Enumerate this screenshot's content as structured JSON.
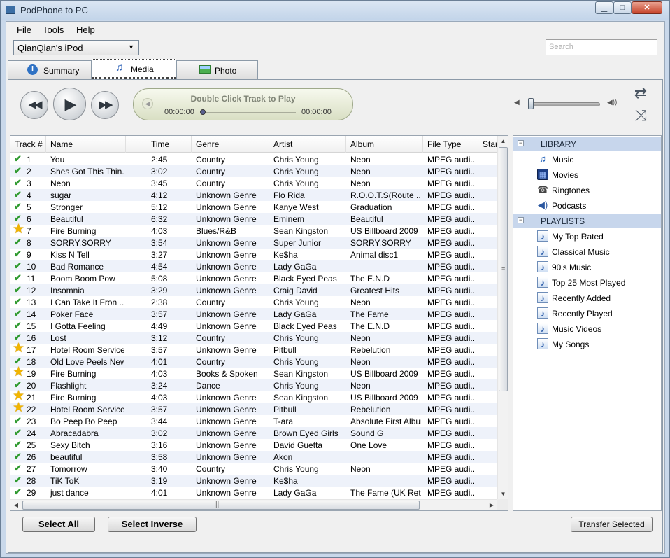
{
  "window": {
    "title": "PodPhone to PC"
  },
  "menu": {
    "file": "File",
    "tools": "Tools",
    "help": "Help"
  },
  "device": {
    "selected": "QianQian's iPod"
  },
  "search": {
    "placeholder": "Search"
  },
  "tabs": {
    "summary": "Summary",
    "media": "Media",
    "photo": "Photo"
  },
  "player": {
    "now_playing": "Double Click Track to Play",
    "time_current": "00:00:00",
    "time_total": "00:00:00"
  },
  "table": {
    "columns": [
      "Track #",
      "Name",
      "Time",
      "Genre",
      "Artist",
      "Album",
      "File Type",
      "Star"
    ],
    "rows": [
      {
        "num": "1",
        "name": "You",
        "time": "2:45",
        "genre": "Country",
        "artist": "Chris Young",
        "album": "Neon",
        "type": "MPEG audi...",
        "starred": false
      },
      {
        "num": "2",
        "name": "Shes Got This Thin...",
        "time": "3:02",
        "genre": "Country",
        "artist": "Chris Young",
        "album": "Neon",
        "type": "MPEG audi...",
        "starred": false
      },
      {
        "num": "3",
        "name": "Neon",
        "time": "3:45",
        "genre": "Country",
        "artist": "Chris Young",
        "album": "Neon",
        "type": "MPEG audi...",
        "starred": false
      },
      {
        "num": "4",
        "name": "sugar",
        "time": "4:12",
        "genre": "Unknown Genre",
        "artist": "Flo Rida",
        "album": "R.O.O.T.S(Route ...",
        "type": "MPEG audi...",
        "starred": false
      },
      {
        "num": "5",
        "name": "Stronger",
        "time": "5:12",
        "genre": "Unknown Genre",
        "artist": "Kanye West",
        "album": "Graduation",
        "type": "MPEG audi...",
        "starred": false
      },
      {
        "num": "6",
        "name": "Beautiful",
        "time": "6:32",
        "genre": "Unknown Genre",
        "artist": "Eminem",
        "album": "Beautiful",
        "type": "MPEG audi...",
        "starred": false
      },
      {
        "num": "7",
        "name": "Fire Burning",
        "time": "4:03",
        "genre": "Blues/R&B",
        "artist": "Sean Kingston",
        "album": "US Billboard 2009 ...",
        "type": "MPEG audi...",
        "starred": true
      },
      {
        "num": "8",
        "name": "SORRY,SORRY",
        "time": "3:54",
        "genre": "Unknown Genre",
        "artist": "Super Junior",
        "album": "SORRY,SORRY",
        "type": "MPEG audi...",
        "starred": false
      },
      {
        "num": "9",
        "name": "Kiss N Tell",
        "time": "3:27",
        "genre": "Unknown Genre",
        "artist": "Ke$ha",
        "album": "Animal disc1",
        "type": "MPEG audi...",
        "starred": false
      },
      {
        "num": "10",
        "name": "Bad Romance",
        "time": "4:54",
        "genre": "Unknown Genre",
        "artist": "Lady GaGa",
        "album": "",
        "type": "MPEG audi...",
        "starred": false
      },
      {
        "num": "11",
        "name": "Boom Boom Pow",
        "time": "5:08",
        "genre": "Unknown Genre",
        "artist": "Black Eyed Peas",
        "album": "The E.N.D",
        "type": "MPEG audi...",
        "starred": false
      },
      {
        "num": "12",
        "name": "Insomnia",
        "time": "3:29",
        "genre": "Unknown Genre",
        "artist": "Craig David",
        "album": "Greatest Hits",
        "type": "MPEG audi...",
        "starred": false
      },
      {
        "num": "13",
        "name": "I Can Take It Fron ...",
        "time": "2:38",
        "genre": "Country",
        "artist": "Chris Young",
        "album": "Neon",
        "type": "MPEG audi...",
        "starred": false
      },
      {
        "num": "14",
        "name": "Poker Face",
        "time": "3:57",
        "genre": "Unknown Genre",
        "artist": "Lady GaGa",
        "album": "The Fame",
        "type": "MPEG audi...",
        "starred": false
      },
      {
        "num": "15",
        "name": "I Gotta Feeling",
        "time": "4:49",
        "genre": "Unknown Genre",
        "artist": "Black Eyed Peas",
        "album": "The E.N.D",
        "type": "MPEG audi...",
        "starred": false
      },
      {
        "num": "16",
        "name": "Lost",
        "time": "3:12",
        "genre": "Country",
        "artist": "Chris Young",
        "album": "Neon",
        "type": "MPEG audi...",
        "starred": false
      },
      {
        "num": "17",
        "name": "Hotel Room Service",
        "time": "3:57",
        "genre": "Unknown Genre",
        "artist": "Pitbull",
        "album": "Rebelution",
        "type": "MPEG audi...",
        "starred": true
      },
      {
        "num": "18",
        "name": "Old Love Peels New",
        "time": "4:01",
        "genre": "Country",
        "artist": "Chris Young",
        "album": "Neon",
        "type": "MPEG audi...",
        "starred": false
      },
      {
        "num": "19",
        "name": "Fire Burning",
        "time": "4:03",
        "genre": "Books & Spoken",
        "artist": "Sean Kingston",
        "album": "US Billboard 2009 ...",
        "type": "MPEG audi...",
        "starred": true
      },
      {
        "num": "20",
        "name": "Flashlight",
        "time": "3:24",
        "genre": "Dance",
        "artist": "Chris Young",
        "album": "Neon",
        "type": "MPEG audi...",
        "starred": false
      },
      {
        "num": "21",
        "name": "Fire Burning",
        "time": "4:03",
        "genre": "Unknown Genre",
        "artist": "Sean Kingston",
        "album": "US Billboard 2009 ...",
        "type": "MPEG audi...",
        "starred": true
      },
      {
        "num": "22",
        "name": "Hotel Room Service",
        "time": "3:57",
        "genre": "Unknown Genre",
        "artist": "Pitbull",
        "album": "Rebelution",
        "type": "MPEG audi...",
        "starred": true
      },
      {
        "num": "23",
        "name": "Bo Peep Bo Peep",
        "time": "3:44",
        "genre": "Unknown Genre",
        "artist": "T-ara",
        "album": "Absolute First Album",
        "type": "MPEG audi...",
        "starred": false
      },
      {
        "num": "24",
        "name": "Abracadabra",
        "time": "3:02",
        "genre": "Unknown Genre",
        "artist": "Brown Eyed Girls",
        "album": "Sound G",
        "type": "MPEG audi...",
        "starred": false
      },
      {
        "num": "25",
        "name": "Sexy Bitch",
        "time": "3:16",
        "genre": "Unknown Genre",
        "artist": "David Guetta",
        "album": "One Love",
        "type": "MPEG audi...",
        "starred": false
      },
      {
        "num": "26",
        "name": "beautiful",
        "time": "3:58",
        "genre": "Unknown Genre",
        "artist": "Akon",
        "album": "",
        "type": "MPEG audi...",
        "starred": false
      },
      {
        "num": "27",
        "name": "Tomorrow",
        "time": "3:40",
        "genre": "Country",
        "artist": "Chris Young",
        "album": "Neon",
        "type": "MPEG audi...",
        "starred": false
      },
      {
        "num": "28",
        "name": "TiK ToK",
        "time": "3:19",
        "genre": "Unknown Genre",
        "artist": "Ke$ha",
        "album": "",
        "type": "MPEG audi...",
        "starred": false
      },
      {
        "num": "29",
        "name": "just dance",
        "time": "4:01",
        "genre": "Unknown Genre",
        "artist": "Lady GaGa",
        "album": "The Fame (UK Ret...",
        "type": "MPEG audi...",
        "starred": false
      }
    ]
  },
  "library": {
    "header": "LIBRARY",
    "items": [
      {
        "label": "Music",
        "icon": "music-icon"
      },
      {
        "label": "Movies",
        "icon": "movie-icon"
      },
      {
        "label": "Ringtones",
        "icon": "ringtone-icon"
      },
      {
        "label": "Podcasts",
        "icon": "podcast-icon"
      }
    ]
  },
  "playlists": {
    "header": "PLAYLISTS",
    "items": [
      {
        "label": "My Top Rated"
      },
      {
        "label": "Classical Music"
      },
      {
        "label": "90's Music"
      },
      {
        "label": "Top 25 Most Played"
      },
      {
        "label": "Recently Added"
      },
      {
        "label": "Recently Played"
      },
      {
        "label": "Music Videos"
      },
      {
        "label": "My Songs"
      }
    ]
  },
  "actions": {
    "select_all": "Select All",
    "select_inverse": "Select Inverse",
    "transfer_selected": "Transfer Selected"
  },
  "player_state": {
    "volume": 0.02,
    "progress": 0.0
  }
}
